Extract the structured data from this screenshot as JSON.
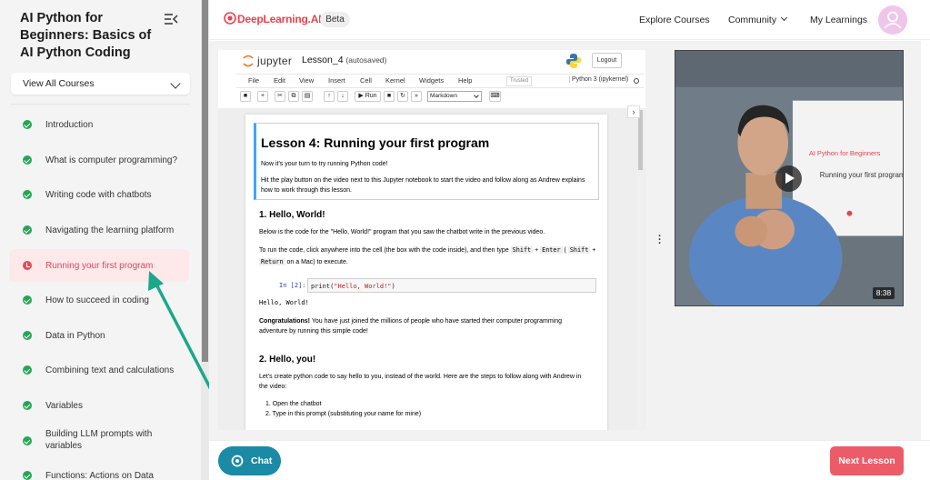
{
  "sidebar": {
    "course_title": "AI Python for Beginners: Basics of AI Python Coding",
    "view_all_label": "View All Courses",
    "lessons": [
      {
        "label": "Introduction",
        "status": "done"
      },
      {
        "label": "What is computer programming?",
        "status": "done"
      },
      {
        "label": "Writing code with chatbots",
        "status": "done"
      },
      {
        "label": "Navigating the learning platform",
        "status": "done"
      },
      {
        "label": "Running your first program",
        "status": "current"
      },
      {
        "label": "How to succeed in coding",
        "status": "done"
      },
      {
        "label": "Data in Python",
        "status": "done"
      },
      {
        "label": "Combining text and calculations",
        "status": "done"
      },
      {
        "label": "Variables",
        "status": "done"
      },
      {
        "label": "Building LLM prompts with variables",
        "status": "done"
      },
      {
        "label": "Functions: Actions on Data",
        "status": "done"
      }
    ]
  },
  "topbar": {
    "brand": "DeepLearning.AI",
    "beta_label": "Beta",
    "nav": [
      "Explore Courses",
      "Community",
      "My Learnings"
    ]
  },
  "notebook": {
    "jupyter_label": "jupyter",
    "notebook_name": "Lesson_4",
    "autosaved": "(autosaved)",
    "logout_label": "Logout",
    "menu": [
      "File",
      "Edit",
      "View",
      "Insert",
      "Cell",
      "Kernel",
      "Widgets",
      "Help"
    ],
    "trusted_label": "Trusted",
    "kernel_label": "Python 3 (ipykernel)",
    "run_label": "Run",
    "cell_type": "Markdown",
    "lesson_heading": "Lesson 4: Running your first program",
    "intro_text1": "Now it's your turn to try running Python code!",
    "intro_text2": "Hit the play button on the video next to this Jupyter notebook to start the video and follow along as Andrew explains how to work through this lesson.",
    "section1_heading": "1. Hello, World!",
    "section1_p1": "Below is the code for the \"Hello, World!\" program that you saw the chatbot write in the previous video.",
    "section1_p2_a": "To run the code, click anywhere into the cell (the box with the code inside), and then type ",
    "key_shift": "Shift",
    "key_plus": " + ",
    "key_enter": "Enter",
    "paren_open": " ( ",
    "key_return": "Return",
    "section1_p2_b": " on a Mac) to execute.",
    "in_prompt": "In [2]:",
    "code_fn": "print(",
    "code_str": "\"Hello, World!\"",
    "code_close": ")",
    "output": "Hello, World!",
    "congrats_bold": "Congratulations!",
    "congrats_text": " You have just joined the millions of people who have started their computer programming adventure by running this simple code!",
    "section2_heading": "2. Hello, you!",
    "section2_p1": "Let's create python code to say hello to you, instead of the world. Here are the steps to follow along with Andrew in the video:",
    "steps": [
      "Open the chatbot",
      "Type in this prompt (substituting your name for mine)"
    ]
  },
  "video": {
    "slide_title": "AI Python for Beginners",
    "slide_sub": "Running your first program",
    "duration": "8:38"
  },
  "bottom": {
    "chat_label": "Chat",
    "next_label": "Next Lesson"
  },
  "colors": {
    "brand": "#e8434f",
    "done": "#26a556",
    "current": "#e84a5b",
    "chat": "#1a8aa5",
    "next": "#ec5c68",
    "annotation_arrow": "#1aa88a"
  }
}
